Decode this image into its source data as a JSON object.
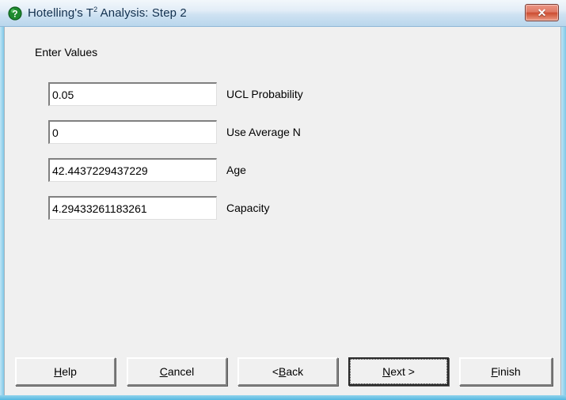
{
  "window": {
    "title_prefix": "Hotelling's T",
    "title_superscript": "2",
    "title_suffix": " Analysis: Step 2",
    "icon": "question-help-icon",
    "close_label": "✕",
    "accent_titlebar": "#cfe2f2",
    "accent_close": "#cc4d33",
    "client_background": "#f0f0f0",
    "frame_color": "#7ec8e8"
  },
  "main": {
    "section_label": "Enter Values",
    "fields": [
      {
        "value": "0.05",
        "label": "UCL Probability"
      },
      {
        "value": "0",
        "label": "Use Average N"
      },
      {
        "value": "42.4437229437229",
        "label": "Age"
      },
      {
        "value": "4.29433261183261",
        "label": "Capacity"
      }
    ]
  },
  "footer": {
    "buttons": [
      {
        "name": "help",
        "pre": "",
        "mnemonic": "H",
        "post": "elp"
      },
      {
        "name": "cancel",
        "pre": "",
        "mnemonic": "C",
        "post": "ancel"
      },
      {
        "name": "back",
        "pre": "< ",
        "mnemonic": "B",
        "post": "ack"
      },
      {
        "name": "next",
        "pre": "",
        "mnemonic": "N",
        "post": "ext >"
      },
      {
        "name": "finish",
        "pre": "",
        "mnemonic": "F",
        "post": "inish"
      }
    ]
  }
}
